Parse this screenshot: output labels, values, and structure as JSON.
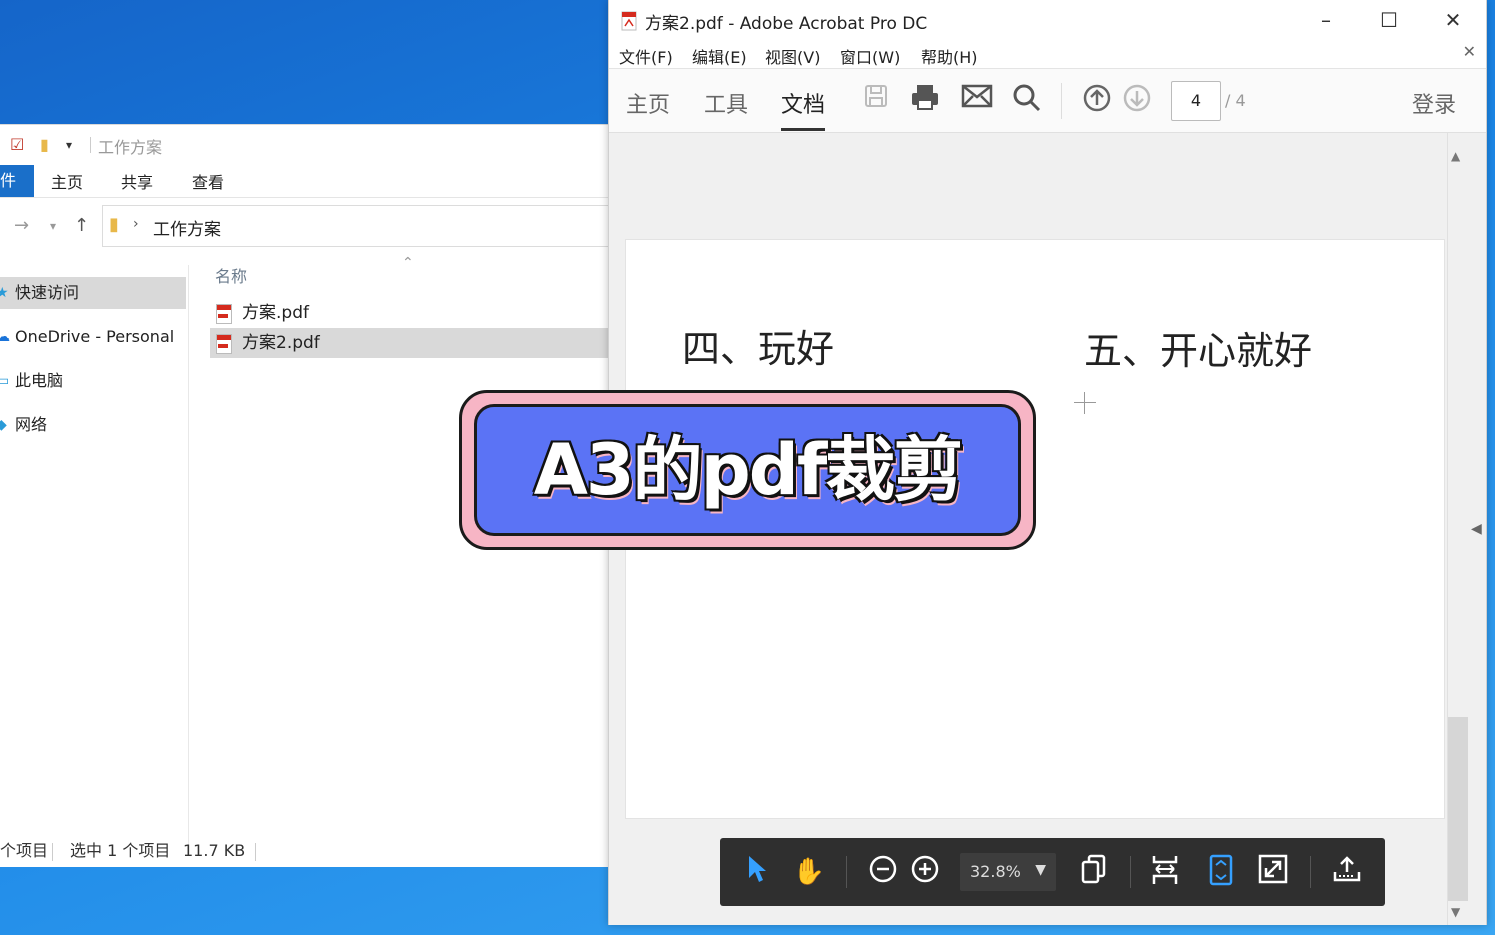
{
  "explorer": {
    "qa_title": "工作方案",
    "ribbon": {
      "file": "件",
      "home": "主页",
      "share": "共享",
      "view": "查看"
    },
    "address": {
      "path": "工作方案"
    },
    "nav": [
      "快速访问",
      "OneDrive - Personal",
      "此电脑",
      "网络"
    ],
    "column_name": "名称",
    "files": [
      "方案.pdf",
      "方案2.pdf"
    ],
    "status": {
      "items": "个项目",
      "selected": "选中 1 个项目",
      "size": "11.7 KB"
    }
  },
  "acrobat": {
    "title": "方案2.pdf - Adobe Acrobat Pro DC",
    "menus": [
      "文件(F)",
      "编辑(E)",
      "视图(V)",
      "窗口(W)",
      "帮助(H)"
    ],
    "tabs": {
      "home": "主页",
      "tools": "工具",
      "doc": "文档"
    },
    "page_current": "4",
    "page_total": "/ 4",
    "login": "登录",
    "page_text": {
      "left": "四、玩好",
      "right": "五、开心就好"
    },
    "zoom": "32.8%"
  },
  "banner": {
    "text": "A3的pdf裁剪"
  },
  "colors": {
    "banner_fill": "#5b73f5",
    "banner_border": "#f7b5c5",
    "desktop": "#1b86e6"
  }
}
